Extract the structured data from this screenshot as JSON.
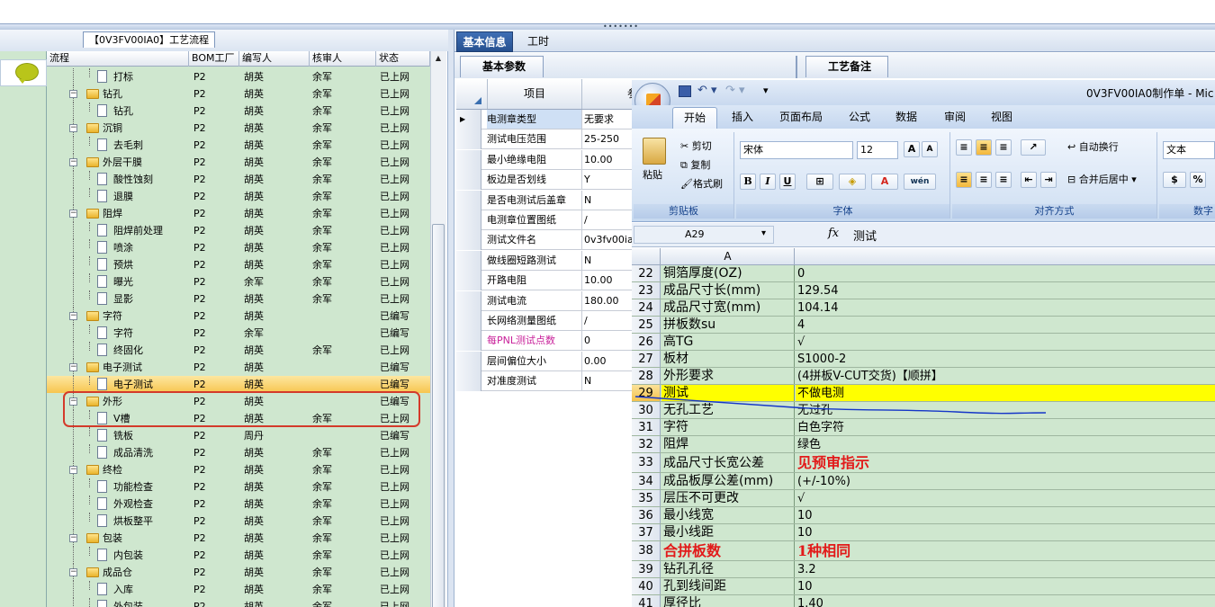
{
  "left": {
    "title": "【0V3FV00IA0】工艺流程",
    "columns": [
      "流程",
      "BOM工厂",
      "编写人",
      "核审人",
      "状态"
    ],
    "rows": [
      {
        "name": "打标",
        "kind": "leaf",
        "plant": "P2",
        "writer": "胡英",
        "reviewer": "余军",
        "status": "已上网"
      },
      {
        "name": "钻孔",
        "kind": "group",
        "plant": "P2",
        "writer": "胡英",
        "reviewer": "余军",
        "status": "已上网"
      },
      {
        "name": "钻孔",
        "kind": "leaf",
        "plant": "P2",
        "writer": "胡英",
        "reviewer": "余军",
        "status": "已上网"
      },
      {
        "name": "沉铜",
        "kind": "group",
        "plant": "P2",
        "writer": "胡英",
        "reviewer": "余军",
        "status": "已上网"
      },
      {
        "name": "去毛刺",
        "kind": "leaf",
        "plant": "P2",
        "writer": "胡英",
        "reviewer": "余军",
        "status": "已上网"
      },
      {
        "name": "外层干膜",
        "kind": "group",
        "plant": "P2",
        "writer": "胡英",
        "reviewer": "余军",
        "status": "已上网"
      },
      {
        "name": "酸性蚀刻",
        "kind": "leaf",
        "plant": "P2",
        "writer": "胡英",
        "reviewer": "余军",
        "status": "已上网"
      },
      {
        "name": "退膜",
        "kind": "leaf",
        "plant": "P2",
        "writer": "胡英",
        "reviewer": "余军",
        "status": "已上网"
      },
      {
        "name": "阻焊",
        "kind": "group",
        "plant": "P2",
        "writer": "胡英",
        "reviewer": "余军",
        "status": "已上网"
      },
      {
        "name": "阻焊前处理",
        "kind": "leaf",
        "plant": "P2",
        "writer": "胡英",
        "reviewer": "余军",
        "status": "已上网"
      },
      {
        "name": "喷涂",
        "kind": "leaf",
        "plant": "P2",
        "writer": "胡英",
        "reviewer": "余军",
        "status": "已上网"
      },
      {
        "name": "预烘",
        "kind": "leaf",
        "plant": "P2",
        "writer": "胡英",
        "reviewer": "余军",
        "status": "已上网"
      },
      {
        "name": "曝光",
        "kind": "leaf",
        "plant": "P2",
        "writer": "余军",
        "reviewer": "余军",
        "status": "已上网"
      },
      {
        "name": "显影",
        "kind": "leaf",
        "plant": "P2",
        "writer": "胡英",
        "reviewer": "余军",
        "status": "已上网"
      },
      {
        "name": "字符",
        "kind": "group",
        "plant": "P2",
        "writer": "胡英",
        "reviewer": "",
        "status": "已编写"
      },
      {
        "name": "字符",
        "kind": "leaf",
        "plant": "P2",
        "writer": "余军",
        "reviewer": "",
        "status": "已编写"
      },
      {
        "name": "终固化",
        "kind": "leaf",
        "plant": "P2",
        "writer": "胡英",
        "reviewer": "余军",
        "status": "已上网"
      },
      {
        "name": "电子测试",
        "kind": "group",
        "plant": "P2",
        "writer": "胡英",
        "reviewer": "",
        "status": "已编写"
      },
      {
        "name": "电子测试",
        "kind": "leaf",
        "plant": "P2",
        "writer": "胡英",
        "reviewer": "",
        "status": "已编写",
        "selected": true
      },
      {
        "name": "外形",
        "kind": "group",
        "plant": "P2",
        "writer": "胡英",
        "reviewer": "",
        "status": "已编写"
      },
      {
        "name": "V槽",
        "kind": "leaf",
        "plant": "P2",
        "writer": "胡英",
        "reviewer": "余军",
        "status": "已上网"
      },
      {
        "name": "铣板",
        "kind": "leaf",
        "plant": "P2",
        "writer": "周丹",
        "reviewer": "",
        "status": "已编写"
      },
      {
        "name": "成品清洗",
        "kind": "leaf",
        "plant": "P2",
        "writer": "胡英",
        "reviewer": "余军",
        "status": "已上网"
      },
      {
        "name": "终检",
        "kind": "group",
        "plant": "P2",
        "writer": "胡英",
        "reviewer": "余军",
        "status": "已上网"
      },
      {
        "name": "功能检查",
        "kind": "leaf",
        "plant": "P2",
        "writer": "胡英",
        "reviewer": "余军",
        "status": "已上网"
      },
      {
        "name": "外观检查",
        "kind": "leaf",
        "plant": "P2",
        "writer": "胡英",
        "reviewer": "余军",
        "status": "已上网"
      },
      {
        "name": "烘板整平",
        "kind": "leaf",
        "plant": "P2",
        "writer": "胡英",
        "reviewer": "余军",
        "status": "已上网"
      },
      {
        "name": "包装",
        "kind": "group",
        "plant": "P2",
        "writer": "胡英",
        "reviewer": "余军",
        "status": "已上网"
      },
      {
        "name": "内包装",
        "kind": "leaf",
        "plant": "P2",
        "writer": "胡英",
        "reviewer": "余军",
        "status": "已上网"
      },
      {
        "name": "成品仓",
        "kind": "group",
        "plant": "P2",
        "writer": "胡英",
        "reviewer": "余军",
        "status": "已上网"
      },
      {
        "name": "入库",
        "kind": "leaf",
        "plant": "P2",
        "writer": "胡英",
        "reviewer": "余军",
        "status": "已上网"
      },
      {
        "name": "外包装",
        "kind": "leaf",
        "plant": "P2",
        "writer": "胡英",
        "reviewer": "余军",
        "status": "已上网"
      }
    ]
  },
  "tabs": {
    "main": [
      "基本信息",
      "工时"
    ],
    "sub": [
      "基本参数",
      "工艺备注"
    ]
  },
  "params": {
    "header": "项目",
    "header2": "参",
    "rows": [
      {
        "name": "电测章类型",
        "value": "无要求",
        "current": true
      },
      {
        "name": "测试电压范围",
        "value": "25-250"
      },
      {
        "name": "最小绝缘电阻",
        "value": "10.00"
      },
      {
        "name": "板边是否划线",
        "value": "Y"
      },
      {
        "name": "是否电测试后盖章",
        "value": "N"
      },
      {
        "name": "电测章位置图纸",
        "value": "/"
      },
      {
        "name": "测试文件名",
        "value": "0v3fv00ia"
      },
      {
        "name": "做线圈短路测试",
        "value": "N"
      },
      {
        "name": "开路电阻",
        "value": "10.00"
      },
      {
        "name": "测试电流",
        "value": "180.00"
      },
      {
        "name": "长网络测量图纸",
        "value": "/"
      },
      {
        "name": "每PNL测试点数",
        "value": "0",
        "accent": "#c8209a"
      },
      {
        "name": "层间偏位大小",
        "value": "0.00"
      },
      {
        "name": "对准度测试",
        "value": "N"
      }
    ]
  },
  "excel": {
    "title": "0V3FV00IA0制作单 - Mic",
    "ribbon_tabs": [
      "开始",
      "插入",
      "页面布局",
      "公式",
      "数据",
      "审阅",
      "视图"
    ],
    "clipboard": {
      "paste": "粘贴",
      "cut": "剪切",
      "copy": "复制",
      "format": "格式刷",
      "label": "剪贴板"
    },
    "font": {
      "name": "宋体",
      "size": "12",
      "label": "字体"
    },
    "align": {
      "wrap": "自动换行",
      "merge": "合并后居中",
      "label": "对齐方式"
    },
    "number": {
      "format": "文本",
      "label": "数字",
      "percent": "%"
    },
    "namebox": "A29",
    "formula": "测试",
    "col_a": "A",
    "rows": [
      {
        "n": "22",
        "a": "铜箔厚度(OZ)",
        "b": "0"
      },
      {
        "n": "23",
        "a": "成品尺寸长(mm)",
        "b": "129.54"
      },
      {
        "n": "24",
        "a": "成品尺寸宽(mm)",
        "b": "104.14"
      },
      {
        "n": "25",
        "a": "拼板数su",
        "b": "4"
      },
      {
        "n": "26",
        "a": "高TG",
        "b": "√"
      },
      {
        "n": "27",
        "a": "板材",
        "b": "S1000-2"
      },
      {
        "n": "28",
        "a": "外形要求",
        "b": "(4拼板V-CUT交货)【顺拼】"
      },
      {
        "n": "29",
        "a": "测试",
        "b": "不做电测",
        "hl": true
      },
      {
        "n": "30",
        "a": "无孔工艺",
        "b": "无过孔"
      },
      {
        "n": "31",
        "a": "字符",
        "b": "白色字符"
      },
      {
        "n": "32",
        "a": "阻焊",
        "b": "绿色"
      },
      {
        "n": "33",
        "a": "成品尺寸长宽公差",
        "b": "见预审指示",
        "bigb": true
      },
      {
        "n": "34",
        "a": "成品板厚公差(mm)",
        "b": "(+/-10%)"
      },
      {
        "n": "35",
        "a": "层压不可更改",
        "b": "√"
      },
      {
        "n": "36",
        "a": "最小线宽",
        "b": "10"
      },
      {
        "n": "37",
        "a": "最小线距",
        "b": "10"
      },
      {
        "n": "38",
        "a": "合拼板数",
        "b": "1种相同",
        "biga": true,
        "bigb": true
      },
      {
        "n": "39",
        "a": "钻孔孔径",
        "b": "3.2"
      },
      {
        "n": "40",
        "a": "孔到线间距",
        "b": "10"
      },
      {
        "n": "41",
        "a": "厚径比",
        "b": "1.40"
      }
    ]
  }
}
